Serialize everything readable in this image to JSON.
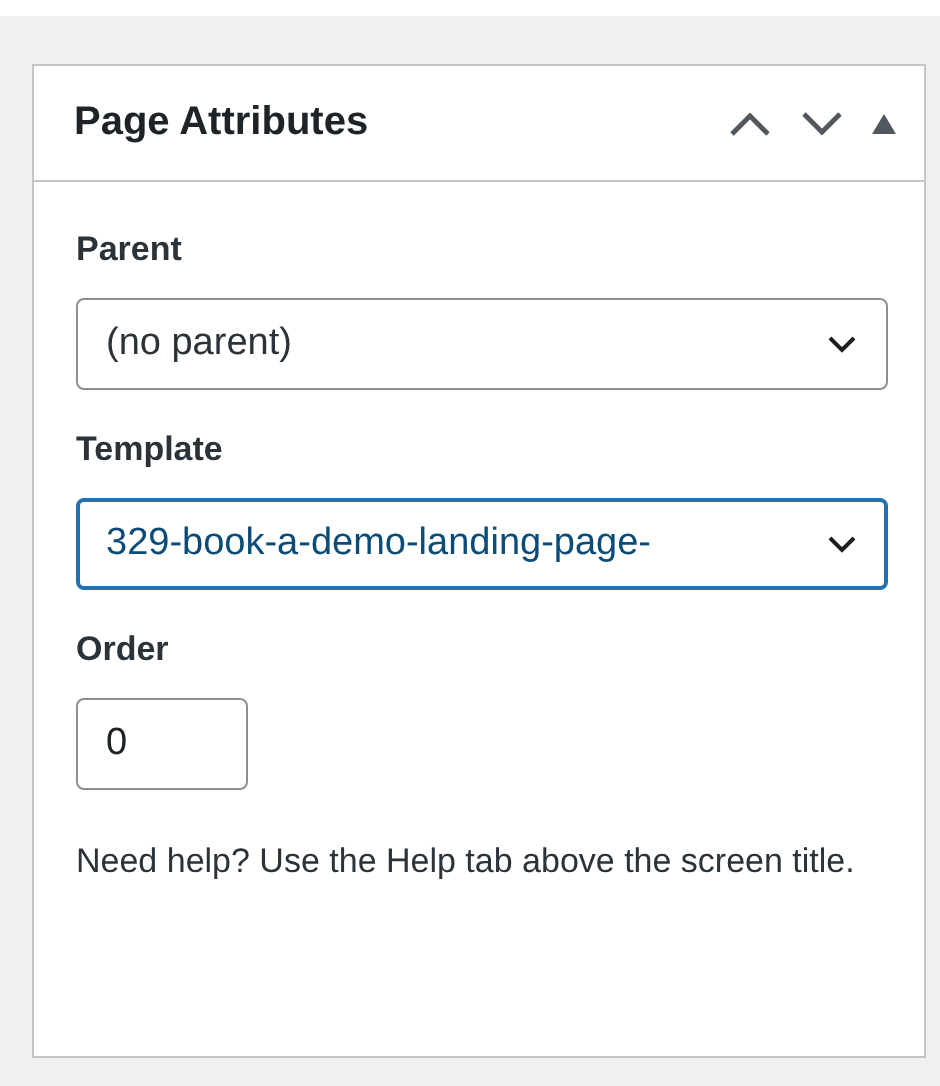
{
  "panel": {
    "title": "Page Attributes",
    "expanded": true
  },
  "fields": [
    {
      "kind": "select",
      "label": "Parent",
      "value": "(no parent)",
      "focused": false
    },
    {
      "kind": "select",
      "label": "Template",
      "value": "329-book-a-demo-landing-page-",
      "focused": true
    },
    {
      "kind": "number",
      "label": "Order",
      "value": "0",
      "focused": false
    }
  ],
  "help": "Need help? Use the Help tab above the screen title."
}
